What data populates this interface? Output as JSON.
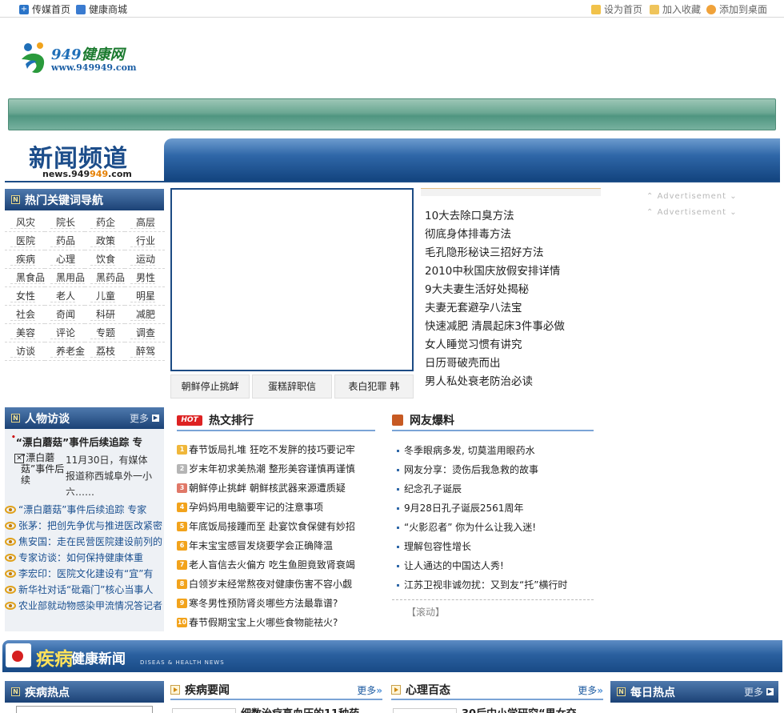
{
  "topbar": {
    "left_links": [
      "传媒首页",
      "健康商城"
    ],
    "right_links": [
      "设为首页",
      "加入收藏",
      "添加到桌面"
    ]
  },
  "logo": {
    "brand_num": "949",
    "brand_name": "健康网",
    "url": "www.949949.com"
  },
  "channel": {
    "title": "新闻频道",
    "url_prefix": "news.949",
    "url_highlight": "949",
    "url_suffix": ".com"
  },
  "keywords": {
    "title": "热门关键词导航",
    "items": [
      "风灾",
      "院长",
      "药企",
      "高层",
      "医院",
      "药品",
      "政策",
      "行业",
      "疾病",
      "心理",
      "饮食",
      "运动",
      "黑食品",
      "黑用品",
      "黑药品",
      "男性",
      "女性",
      "老人",
      "儿童",
      "明星",
      "社会",
      "奇闻",
      "科研",
      "减肥",
      "美容",
      "评论",
      "专题",
      "调查",
      "访谈",
      "养老金",
      "荔枝",
      "醉驾"
    ]
  },
  "feature": {
    "thumbs": [
      "朝鲜停止挑衅",
      "蛋糕辞职信",
      "表白犯罪 韩"
    ]
  },
  "headlines": [
    "10大去除口臭方法",
    "彻底身体排毒方法",
    "毛孔隐形秘诀三招好方法",
    "2010中秋国庆放假安排详情",
    "9大夫妻生活好处揭秘",
    "夫妻无套避孕八法宝",
    "快速减肥 清晨起床3件事必做",
    "女人睡觉习惯有讲究",
    "日历哥破壳而出",
    "男人私处衰老防治必读"
  ],
  "ads": [
    "Advertisement",
    "Advertisement"
  ],
  "people": {
    "title": "人物访谈",
    "more": "更多",
    "lead_title": "“漂白蘑菇”事件后续追踪 专",
    "lead_img_alt": "“漂白蘑菇”事件后续",
    "lead_text": "11月30日，有媒体报道称西城阜外一小六……",
    "items": [
      "“漂白蘑菇”事件后续追踪 专家",
      "张茅：把创先争优与推进医改紧密",
      "焦安国：走在民营医院建设前列的",
      "专家访谈：如何保持健康体重",
      "李宏印：医院文化建设有“宜”有",
      "新华社对话“砒霜门”核心当事人",
      "农业部就动物感染甲流情况答记者"
    ]
  },
  "hot": {
    "badge": "HOT",
    "title": "热文排行",
    "items": [
      "春节饭局扎堆 狂吃不发胖的技巧要记牢",
      "岁末年初求美热潮 整形美容谨慎再谨慎",
      "朝鲜停止挑衅 朝鲜核武器来源遭质疑",
      "孕妈妈用电脑要牢记的注意事项",
      "年底饭局接踵而至 赴宴饮食保健有妙招",
      "年末宝宝感冒发烧要学会正确降温",
      "老人盲信去火偏方 吃生鱼胆竟致肾衰竭",
      "白领岁末经常熬夜对健康伤害不容小觑",
      "寒冬男性预防肾炎哪些方法最靠谱?",
      "春节假期宝宝上火哪些食物能祛火?"
    ]
  },
  "net": {
    "title": "网友爆料",
    "items": [
      "冬季眼病多发, 切莫滥用眼药水",
      "网友分享：烫伤后我急救的故事",
      "纪念孔子诞辰",
      "9月28日孔子诞辰2561周年",
      "“火影忍者” 你为什么让我入迷!",
      "理解包容性增长",
      "让人通达的中国达人秀!",
      "江苏卫视非诚勿扰：又到友“托”横行时"
    ],
    "scroll": "【滚动】"
  },
  "disease": {
    "title_hl": "疾病",
    "title_rest": "健康新闻",
    "english": "DISEAS & HEALTH NEWS"
  },
  "bottom": {
    "hot_title": "疾病热点",
    "news_title": "疾病要闻",
    "news_more": "更多",
    "news_cut": "细数治疗高血压的11种药",
    "psy_title": "心理百态",
    "psy_more": "更多",
    "psy_cut": "30后中小学研究“男女交",
    "daily_title": "每日热点",
    "daily_more": "更多"
  },
  "colors": {
    "brand_blue": "#1b4276",
    "nav_green": "#5f9f8a",
    "accent_orange": "#f2a31c"
  }
}
